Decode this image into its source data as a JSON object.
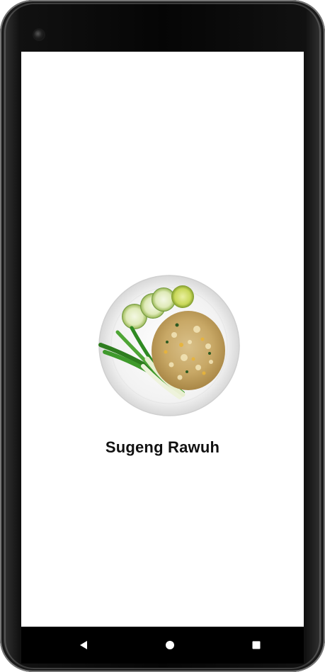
{
  "screen": {
    "welcome_title": "Sugeng Rawuh"
  },
  "hero_image": {
    "icon": "fried-rice-plate-image"
  },
  "navigation": {
    "back_icon": "triangle-back-icon",
    "home_icon": "circle-home-icon",
    "recents_icon": "square-recents-icon"
  },
  "colors": {
    "background": "#ffffff",
    "text": "#111111",
    "nav_bar": "#000000",
    "nav_icons": "#ffffff"
  }
}
